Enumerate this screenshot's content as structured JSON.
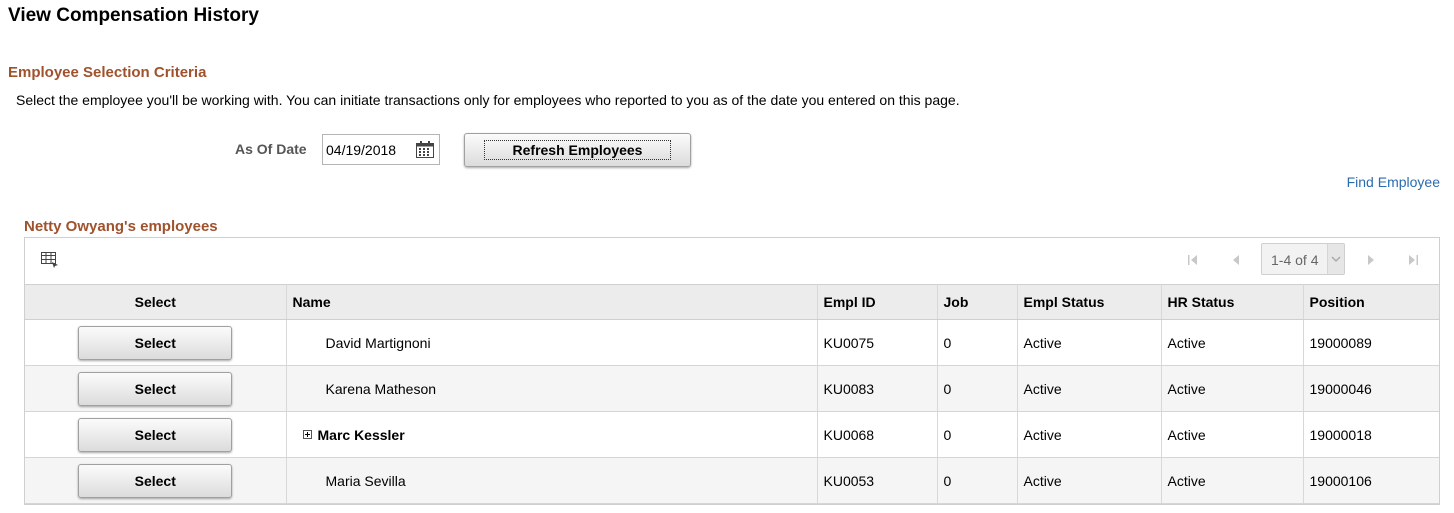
{
  "page": {
    "title": "View Compensation History"
  },
  "criteria": {
    "title": "Employee Selection Criteria",
    "instructions": "Select the employee you'll be working with. You can initiate transactions only for employees who reported to you as of the date you entered on this page.",
    "as_of_label": "As Of Date",
    "as_of_value": "04/19/2018",
    "refresh_label": "Refresh Employees",
    "find_label": "Find Employee"
  },
  "grid": {
    "title": "Netty Owyang's employees",
    "pager": "1-4 of 4",
    "columns": [
      "Select",
      "Name",
      "Empl ID",
      "Job",
      "Empl Status",
      "HR Status",
      "Position"
    ],
    "select_label": "Select",
    "rows": [
      {
        "name": "David Martignoni",
        "empl_id": "KU0075",
        "job": "0",
        "empl_status": "Active",
        "hr_status": "Active",
        "position": "19000089",
        "expandable": false
      },
      {
        "name": "Karena Matheson",
        "empl_id": "KU0083",
        "job": "0",
        "empl_status": "Active",
        "hr_status": "Active",
        "position": "19000046",
        "expandable": false
      },
      {
        "name": "Marc Kessler",
        "empl_id": "KU0068",
        "job": "0",
        "empl_status": "Active",
        "hr_status": "Active",
        "position": "19000018",
        "expandable": true
      },
      {
        "name": "Maria Sevilla",
        "empl_id": "KU0053",
        "job": "0",
        "empl_status": "Active",
        "hr_status": "Active",
        "position": "19000106",
        "expandable": false
      }
    ]
  },
  "icons": {
    "calendar": "calendar-icon",
    "grid_options": "grid-options-icon",
    "first": "first-page-icon",
    "prev": "previous-page-icon",
    "next": "next-page-icon",
    "last": "last-page-icon",
    "expand": "expand-plus-icon"
  },
  "colors": {
    "section_title": "#a0522d",
    "link": "#2b6cb0",
    "header_bg": "#ececec",
    "alt_row_bg": "#f5f5f5"
  }
}
